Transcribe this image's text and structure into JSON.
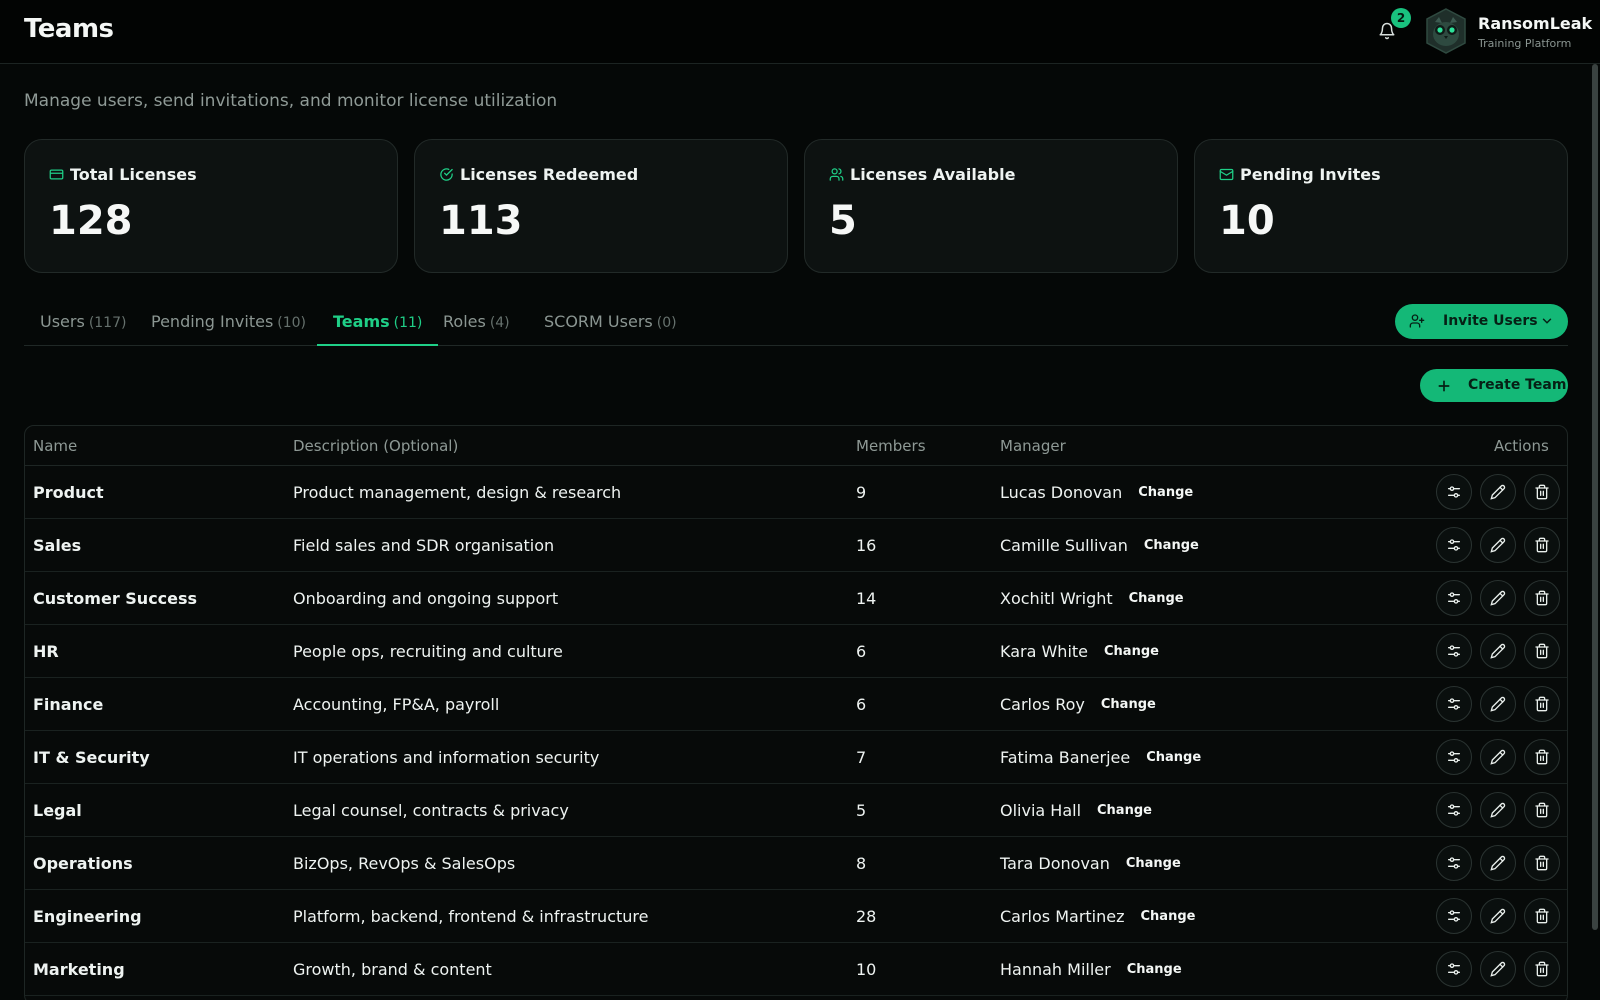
{
  "header": {
    "title": "Teams",
    "notification_count": "2",
    "brand_name": "RansomLeak",
    "brand_sub": "Training Platform"
  },
  "subtitle": "Manage users, send invitations, and monitor license utilization",
  "stats": [
    {
      "label": "Total Licenses",
      "value": "128",
      "icon": "credit-card-icon"
    },
    {
      "label": "Licenses Redeemed",
      "value": "113",
      "icon": "check-circle-icon"
    },
    {
      "label": "Licenses Available",
      "value": "5",
      "icon": "users-icon"
    },
    {
      "label": "Pending Invites",
      "value": "10",
      "icon": "mail-icon"
    }
  ],
  "tabs": [
    {
      "label": "Users",
      "count": "(117)"
    },
    {
      "label": "Pending Invites",
      "count": "(10)"
    },
    {
      "label": "Teams",
      "count": "(11)"
    },
    {
      "label": "Roles",
      "count": "(4)"
    },
    {
      "label": "SCORM Users",
      "count": "(0)"
    }
  ],
  "active_tab": "Teams",
  "buttons": {
    "invite": "Invite Users",
    "create": "Create Team"
  },
  "table": {
    "columns": [
      "Name",
      "Description (Optional)",
      "Members",
      "Manager",
      "Actions"
    ],
    "change_label": "Change",
    "rows": [
      {
        "name": "Product",
        "description": "Product management, design & research",
        "members": "9",
        "manager": "Lucas Donovan"
      },
      {
        "name": "Sales",
        "description": "Field sales and SDR organisation",
        "members": "16",
        "manager": "Camille Sullivan"
      },
      {
        "name": "Customer Success",
        "description": "Onboarding and ongoing support",
        "members": "14",
        "manager": "Xochitl Wright"
      },
      {
        "name": "HR",
        "description": "People ops, recruiting and culture",
        "members": "6",
        "manager": "Kara White"
      },
      {
        "name": "Finance",
        "description": "Accounting, FP&A, payroll",
        "members": "6",
        "manager": "Carlos Roy"
      },
      {
        "name": "IT & Security",
        "description": "IT operations and information security",
        "members": "7",
        "manager": "Fatima Banerjee"
      },
      {
        "name": "Legal",
        "description": "Legal counsel, contracts & privacy",
        "members": "5",
        "manager": "Olivia Hall"
      },
      {
        "name": "Operations",
        "description": "BizOps, RevOps & SalesOps",
        "members": "8",
        "manager": "Tara Donovan"
      },
      {
        "name": "Engineering",
        "description": "Platform, backend, frontend & infrastructure",
        "members": "28",
        "manager": "Carlos Martinez"
      },
      {
        "name": "Marketing",
        "description": "Growth, brand & content",
        "members": "10",
        "manager": "Hannah Miller"
      }
    ]
  },
  "colors": {
    "accent": "#1fcf87",
    "background": "#050807",
    "card": "#0d1211"
  }
}
